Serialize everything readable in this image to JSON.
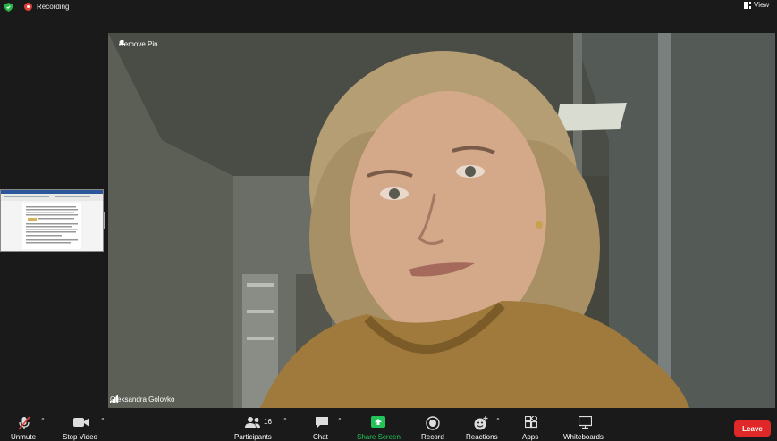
{
  "topbar": {
    "recording_label": "Recording",
    "view_label": "View"
  },
  "main_video": {
    "remove_pin_label": "Remove Pin",
    "participant_name": "Oleksandra Golovko"
  },
  "toolbar": {
    "unmute": "Unmute",
    "stop_video": "Stop Video",
    "participants": "Participants",
    "participants_count": "16",
    "chat": "Chat",
    "share_screen": "Share Screen",
    "record": "Record",
    "reactions": "Reactions",
    "apps": "Apps",
    "whiteboards": "Whiteboards",
    "leave": "Leave"
  },
  "colors": {
    "background": "#1a1a1a",
    "share_screen_accent": "#23c35a",
    "leave_button": "#e02828",
    "recording_dot": "#e0403a",
    "shield": "#2ab54a"
  },
  "icons": [
    "shield-icon",
    "recording-icon",
    "view-icon",
    "pin-icon",
    "signal-icon",
    "microphone-muted-icon",
    "video-camera-icon",
    "participants-icon",
    "chat-icon",
    "share-screen-icon",
    "record-icon",
    "reactions-icon",
    "apps-icon",
    "whiteboard-icon"
  ]
}
